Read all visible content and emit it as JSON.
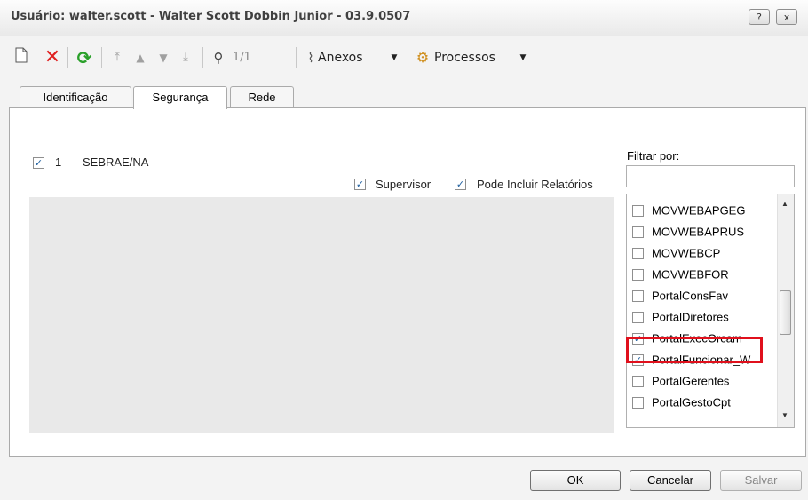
{
  "window": {
    "title": "Usuário: walter.scott - Walter Scott Dobbin Junior - 03.9.0507",
    "help_label": "?",
    "close_label": "x"
  },
  "toolbar": {
    "record_counter": "1/1",
    "attachments_label": "Anexos",
    "processes_label": "Processos"
  },
  "tabs": [
    {
      "label": "Identificação",
      "active": false
    },
    {
      "label": "Segurança",
      "active": true
    },
    {
      "label": "Rede",
      "active": false
    }
  ],
  "security": {
    "row": {
      "checked": true,
      "number": "1",
      "name": "SEBRAE/NA"
    },
    "options": [
      {
        "label": "Supervisor",
        "checked": true
      },
      {
        "label": "Pode Incluir Relatórios",
        "checked": true
      }
    ]
  },
  "filter": {
    "label": "Filtrar por:",
    "value": ""
  },
  "permissions": [
    {
      "label": "MOVWEBAPGEG",
      "checked": false
    },
    {
      "label": "MOVWEBAPRUS",
      "checked": false
    },
    {
      "label": "MOVWEBCP",
      "checked": false
    },
    {
      "label": "MOVWEBFOR",
      "checked": false
    },
    {
      "label": "PortalConsFav",
      "checked": false
    },
    {
      "label": "PortalDiretores",
      "checked": false
    },
    {
      "label": "PortalExecOrcam",
      "checked": true,
      "highlighted": true
    },
    {
      "label": "PortalFuncionar_W",
      "checked": true
    },
    {
      "label": "PortalGerentes",
      "checked": false
    },
    {
      "label": "PortalGestoCpt",
      "checked": false
    }
  ],
  "buttons": {
    "ok": "OK",
    "cancel": "Cancelar",
    "save": "Salvar"
  },
  "colors": {
    "highlight": "#e0101c",
    "check": "#2060a0",
    "refresh_icon": "#2aa02a",
    "delete_icon": "#e02020"
  }
}
